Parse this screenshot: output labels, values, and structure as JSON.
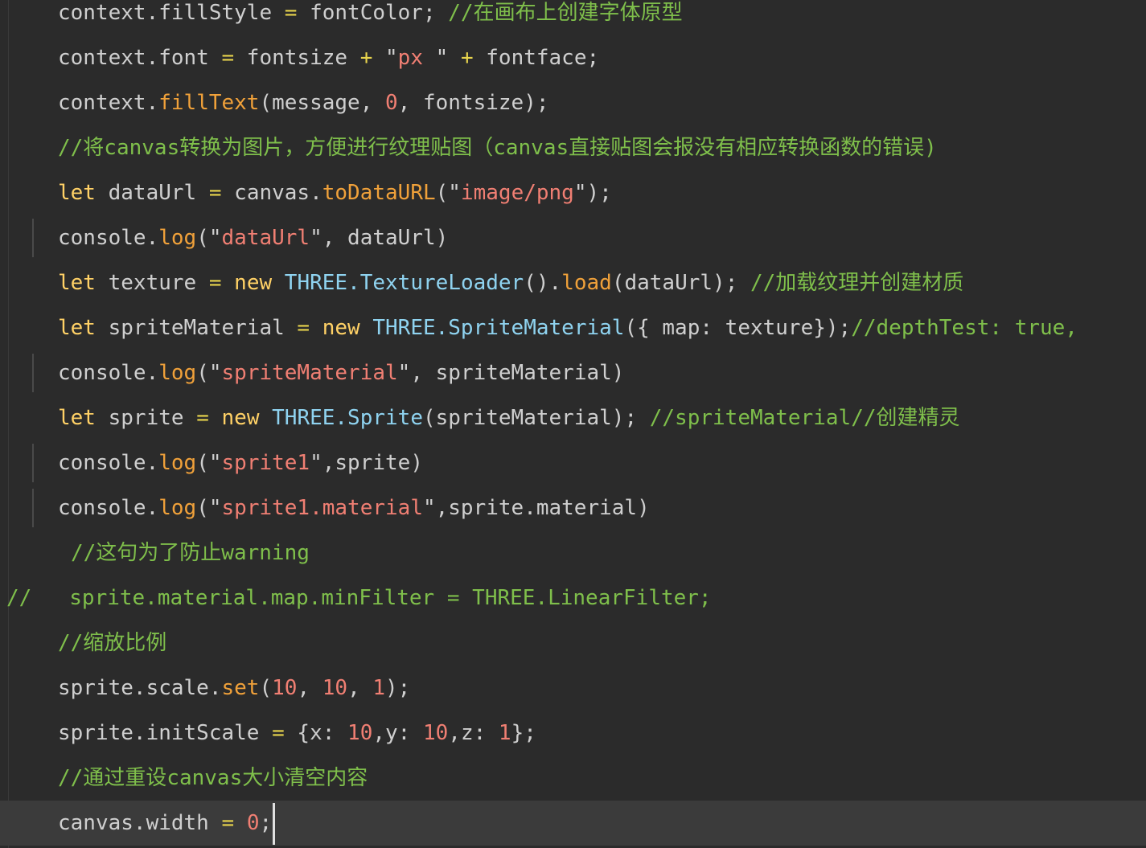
{
  "colors": {
    "background": "#2b2b2b",
    "current_line": "#3b3b3b",
    "default": "#cfcfcf",
    "keyword": "#ffd166",
    "method": "#f0a13a",
    "string": "#f07f73",
    "number": "#f07f73",
    "comment": "#7fbf4b",
    "class": "#8fd3f0",
    "operator": "#e8d44d"
  },
  "lines": [
    {
      "indent": 72,
      "tokens": [
        {
          "t": "context.fillStyle ",
          "c": "default"
        },
        {
          "t": "=",
          "c": "operator"
        },
        {
          "t": " fontColor; ",
          "c": "default"
        },
        {
          "t": "//在画布上创建字体原型",
          "c": "comment"
        }
      ]
    },
    {
      "indent": 72,
      "tokens": [
        {
          "t": "context.font ",
          "c": "default"
        },
        {
          "t": "=",
          "c": "operator"
        },
        {
          "t": " fontsize ",
          "c": "default"
        },
        {
          "t": "+",
          "c": "operator"
        },
        {
          "t": " \"",
          "c": "default"
        },
        {
          "t": "px ",
          "c": "string"
        },
        {
          "t": "\" ",
          "c": "default"
        },
        {
          "t": "+",
          "c": "operator"
        },
        {
          "t": " fontface;",
          "c": "default"
        }
      ]
    },
    {
      "indent": 72,
      "tokens": [
        {
          "t": "context.",
          "c": "default"
        },
        {
          "t": "fillText",
          "c": "method"
        },
        {
          "t": "(message, ",
          "c": "default"
        },
        {
          "t": "0",
          "c": "number"
        },
        {
          "t": ", fontsize);",
          "c": "default"
        }
      ]
    },
    {
      "indent": 72,
      "tokens": [
        {
          "t": "//将canvas转换为图片，方便进行纹理贴图（canvas直接贴图会报没有相应转换函数的错误)",
          "c": "comment"
        }
      ]
    },
    {
      "indent": 72,
      "tokens": [
        {
          "t": "let",
          "c": "keyword"
        },
        {
          "t": " dataUrl ",
          "c": "default"
        },
        {
          "t": "=",
          "c": "operator"
        },
        {
          "t": " canvas.",
          "c": "default"
        },
        {
          "t": "toDataURL",
          "c": "method"
        },
        {
          "t": "(\"",
          "c": "default"
        },
        {
          "t": "image/png",
          "c": "string"
        },
        {
          "t": "\");",
          "c": "default"
        }
      ]
    },
    {
      "indent": 72,
      "guide": true,
      "tokens": [
        {
          "t": "console.",
          "c": "default"
        },
        {
          "t": "log",
          "c": "method"
        },
        {
          "t": "(\"",
          "c": "default"
        },
        {
          "t": "dataUrl",
          "c": "string"
        },
        {
          "t": "\", dataUrl)",
          "c": "default"
        }
      ]
    },
    {
      "indent": 72,
      "tokens": [
        {
          "t": "let",
          "c": "keyword"
        },
        {
          "t": " texture ",
          "c": "default"
        },
        {
          "t": "=",
          "c": "operator"
        },
        {
          "t": " ",
          "c": "default"
        },
        {
          "t": "new",
          "c": "keyword"
        },
        {
          "t": " ",
          "c": "default"
        },
        {
          "t": "THREE.TextureLoader",
          "c": "class"
        },
        {
          "t": "().",
          "c": "default"
        },
        {
          "t": "load",
          "c": "method"
        },
        {
          "t": "(dataUrl); ",
          "c": "default"
        },
        {
          "t": "//加载纹理并创建材质",
          "c": "comment"
        }
      ]
    },
    {
      "indent": 72,
      "tokens": [
        {
          "t": "let",
          "c": "keyword"
        },
        {
          "t": " spriteMaterial ",
          "c": "default"
        },
        {
          "t": "=",
          "c": "operator"
        },
        {
          "t": " ",
          "c": "default"
        },
        {
          "t": "new",
          "c": "keyword"
        },
        {
          "t": " ",
          "c": "default"
        },
        {
          "t": "THREE.SpriteMaterial",
          "c": "class"
        },
        {
          "t": "({ map: texture});",
          "c": "default"
        },
        {
          "t": "//depthTest: true,",
          "c": "comment"
        }
      ]
    },
    {
      "indent": 72,
      "guide": true,
      "tokens": [
        {
          "t": "console.",
          "c": "default"
        },
        {
          "t": "log",
          "c": "method"
        },
        {
          "t": "(\"",
          "c": "default"
        },
        {
          "t": "spriteMaterial",
          "c": "string"
        },
        {
          "t": "\", spriteMaterial)",
          "c": "default"
        }
      ]
    },
    {
      "indent": 72,
      "tokens": [
        {
          "t": "let",
          "c": "keyword"
        },
        {
          "t": " sprite ",
          "c": "default"
        },
        {
          "t": "=",
          "c": "operator"
        },
        {
          "t": " ",
          "c": "default"
        },
        {
          "t": "new",
          "c": "keyword"
        },
        {
          "t": " ",
          "c": "default"
        },
        {
          "t": "THREE.Sprite",
          "c": "class"
        },
        {
          "t": "(spriteMaterial); ",
          "c": "default"
        },
        {
          "t": "//spriteMaterial//创建精灵",
          "c": "comment"
        }
      ]
    },
    {
      "indent": 72,
      "guide": true,
      "tokens": [
        {
          "t": "console.",
          "c": "default"
        },
        {
          "t": "log",
          "c": "method"
        },
        {
          "t": "(\"",
          "c": "default"
        },
        {
          "t": "sprite1",
          "c": "string"
        },
        {
          "t": "\",sprite)",
          "c": "default"
        }
      ]
    },
    {
      "indent": 72,
      "guide": true,
      "tokens": [
        {
          "t": "console.",
          "c": "default"
        },
        {
          "t": "log",
          "c": "method"
        },
        {
          "t": "(\"",
          "c": "default"
        },
        {
          "t": "sprite1.material",
          "c": "string"
        },
        {
          "t": "\",sprite.material)",
          "c": "default"
        }
      ]
    },
    {
      "indent": 88,
      "tokens": [
        {
          "t": "//这句为了防止warning",
          "c": "comment"
        }
      ]
    },
    {
      "indent": 8,
      "tokens": [
        {
          "t": "//   sprite.material.map.minFilter = THREE.LinearFilter;",
          "c": "comment"
        }
      ]
    },
    {
      "indent": 72,
      "tokens": [
        {
          "t": "//缩放比例",
          "c": "comment"
        }
      ]
    },
    {
      "indent": 72,
      "tokens": [
        {
          "t": "sprite.scale.",
          "c": "default"
        },
        {
          "t": "set",
          "c": "method"
        },
        {
          "t": "(",
          "c": "default"
        },
        {
          "t": "10",
          "c": "number"
        },
        {
          "t": ", ",
          "c": "default"
        },
        {
          "t": "10",
          "c": "number"
        },
        {
          "t": ", ",
          "c": "default"
        },
        {
          "t": "1",
          "c": "number"
        },
        {
          "t": ");",
          "c": "default"
        }
      ]
    },
    {
      "indent": 72,
      "tokens": [
        {
          "t": "sprite.initScale ",
          "c": "default"
        },
        {
          "t": "=",
          "c": "operator"
        },
        {
          "t": " {x: ",
          "c": "default"
        },
        {
          "t": "10",
          "c": "number"
        },
        {
          "t": ",y: ",
          "c": "default"
        },
        {
          "t": "10",
          "c": "number"
        },
        {
          "t": ",z: ",
          "c": "default"
        },
        {
          "t": "1",
          "c": "number"
        },
        {
          "t": "};",
          "c": "default"
        }
      ]
    },
    {
      "indent": 72,
      "tokens": [
        {
          "t": "//通过重设canvas大小清空内容",
          "c": "comment"
        }
      ]
    },
    {
      "indent": 72,
      "current": true,
      "tokens": [
        {
          "t": "canvas.width ",
          "c": "default"
        },
        {
          "t": "=",
          "c": "operator"
        },
        {
          "t": " ",
          "c": "default"
        },
        {
          "t": "0",
          "c": "number"
        },
        {
          "t": ";",
          "c": "default"
        }
      ]
    }
  ]
}
